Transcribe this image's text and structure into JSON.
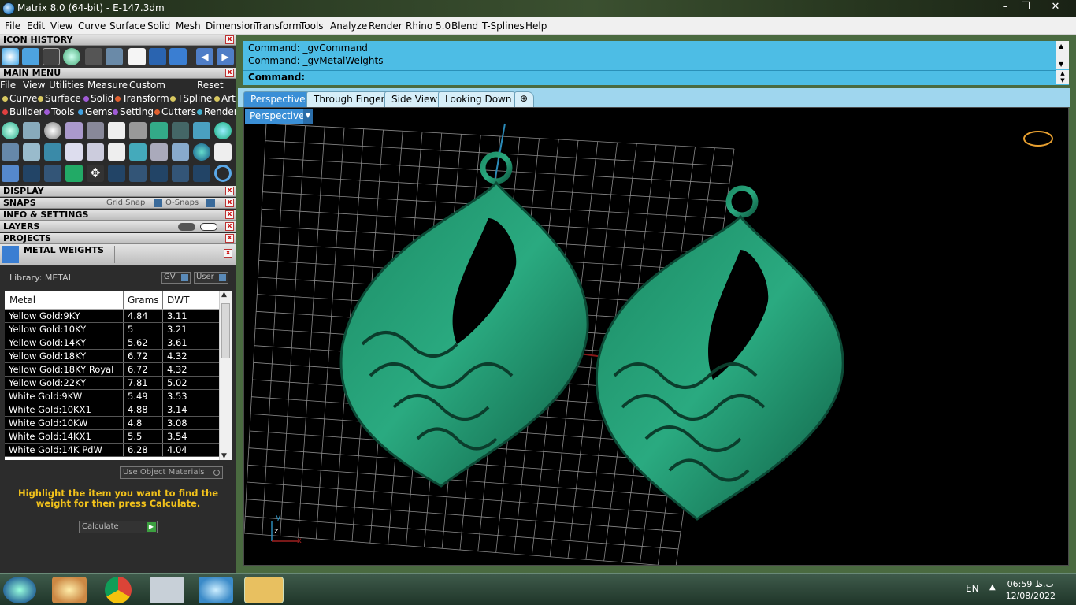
{
  "window": {
    "title": "Matrix 8.0 (64-bit) - E-147.3dm",
    "minimize_icon": "minimize-icon",
    "maximize_icon": "restore-icon",
    "close_icon": "close-icon"
  },
  "menubar": [
    "File",
    "Edit",
    "View",
    "Curve",
    "Surface",
    "Solid",
    "Mesh",
    "Dimension",
    "Transform",
    "Tools",
    "Analyze",
    "Render",
    "Rhino 5.0",
    "Blend",
    "T-Splines",
    "Help"
  ],
  "panels": {
    "icon_history": "ICON HISTORY",
    "main_menu": "MAIN MENU",
    "display": "DISPLAY",
    "snaps": "SNAPS",
    "grid_snap": "Grid Snap",
    "osnaps": "O-Snaps",
    "info_settings": "INFO & SETTINGS",
    "layers": "LAYERS",
    "projects": "PROJECTS",
    "metal_weights": "METAL WEIGHTS"
  },
  "main_menu_row1": [
    "File",
    "View",
    "Utilities",
    "Measure",
    "Custom"
  ],
  "main_menu_reset": "Reset",
  "main_menu_row2": [
    {
      "label": "Curve",
      "color": "#d8c860"
    },
    {
      "label": "Surface",
      "color": "#d8c860"
    },
    {
      "label": "Solid",
      "color": "#a05bd6"
    },
    {
      "label": "Transform",
      "color": "#e06030"
    },
    {
      "label": "TSpline",
      "color": "#d8c860"
    },
    {
      "label": "Art",
      "color": "#d8c860"
    }
  ],
  "main_menu_row3": [
    {
      "label": "Builder",
      "color": "#e04040"
    },
    {
      "label": "Tools",
      "color": "#a05bd6"
    },
    {
      "label": "Gems",
      "color": "#40a0e0"
    },
    {
      "label": "Setting",
      "color": "#a05bd6"
    },
    {
      "label": "Cutters",
      "color": "#e06030"
    },
    {
      "label": "Render",
      "color": "#40b0d0"
    }
  ],
  "metal_weights": {
    "library_label": "Library: METAL",
    "gv_button": "GV",
    "user_button": "User",
    "columns": [
      "Metal",
      "Grams",
      "DWT"
    ],
    "rows": [
      [
        "Yellow Gold:9KY",
        "4.84",
        "3.11"
      ],
      [
        "Yellow Gold:10KY",
        "5",
        "3.21"
      ],
      [
        "Yellow Gold:14KY",
        "5.62",
        "3.61"
      ],
      [
        "Yellow Gold:18KY",
        "6.72",
        "4.32"
      ],
      [
        "Yellow Gold:18KY Royal",
        "6.72",
        "4.32"
      ],
      [
        "Yellow Gold:22KY",
        "7.81",
        "5.02"
      ],
      [
        "White Gold:9KW",
        "5.49",
        "3.53"
      ],
      [
        "White Gold:10KX1",
        "4.88",
        "3.14"
      ],
      [
        "White Gold:10KW",
        "4.8",
        "3.08"
      ],
      [
        "White Gold:14KX1",
        "5.5",
        "3.54"
      ],
      [
        "White Gold:14K PdW",
        "6.28",
        "4.04"
      ]
    ],
    "use_object_materials": "Use Object Materials",
    "instruction": "Highlight the item you want to find the weight for then press Calculate.",
    "calculate": "Calculate"
  },
  "command": {
    "line1": "Command: _gvCommand",
    "line2": "Command: _gvMetalWeights",
    "prompt": "Command:"
  },
  "tabs": [
    {
      "label": "Perspective",
      "active": true
    },
    {
      "label": "Through Finger",
      "active": false
    },
    {
      "label": "Side View",
      "active": false
    },
    {
      "label": "Looking Down",
      "active": false
    }
  ],
  "add_tab_icon": "plus-icon",
  "viewport": {
    "label": "Perspective",
    "axis_y": "y",
    "axis_z": "z",
    "axis_x": "x"
  },
  "taskbar": {
    "language": "EN",
    "time": "06:59 ب.ظ",
    "date": "12/08/2022"
  }
}
